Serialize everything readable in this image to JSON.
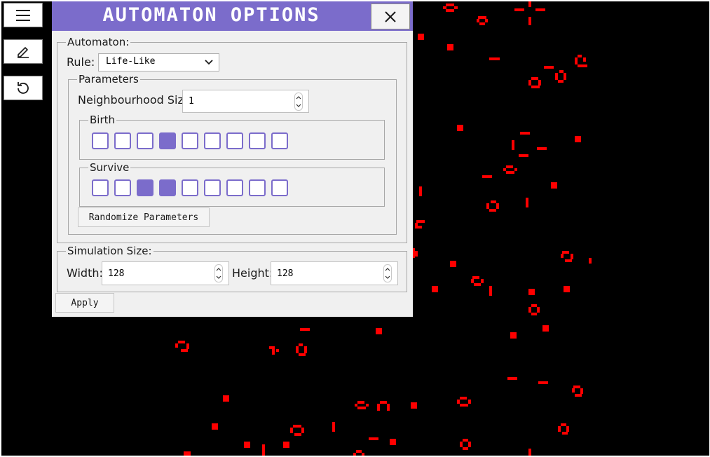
{
  "toolbar": {
    "menu_icon": "hamburger-menu-icon",
    "edit_icon": "pencil-icon",
    "reset_icon": "rotate-ccw-icon"
  },
  "panel": {
    "title": "AUTOMATON OPTIONS",
    "close_icon": "close-x-icon",
    "automaton_legend": "Automaton:",
    "rule_label": "Rule:",
    "rule_value": "Life-Like",
    "parameters_legend": "Parameters",
    "neighbourhood_label": "Neighbourhood Size:",
    "neighbourhood_value": "1",
    "birth_legend": "Birth",
    "birth": [
      false,
      false,
      false,
      true,
      false,
      false,
      false,
      false,
      false
    ],
    "survive_legend": "Survive",
    "survive": [
      false,
      false,
      true,
      true,
      false,
      false,
      false,
      false,
      false
    ],
    "randomize_label": "Randomize Parameters",
    "size_legend": "Simulation Size:",
    "width_label": "Width:",
    "width_value": "128",
    "height_label": "Height:",
    "height_value": "128",
    "apply_label": "Apply"
  },
  "colors": {
    "accent": "#7b6ccb",
    "cell": "#ff0000",
    "background": "#000000"
  }
}
